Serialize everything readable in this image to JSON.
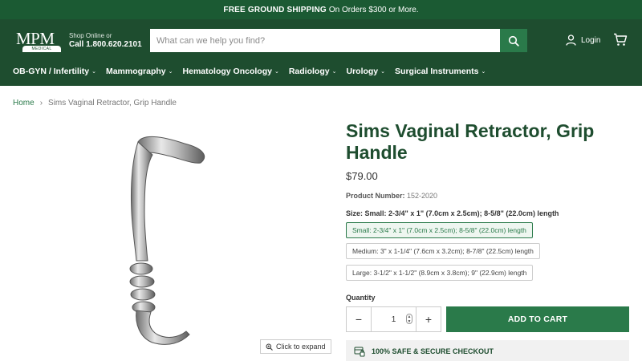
{
  "promo": {
    "strong": "FREE GROUND SHIPPING",
    "rest": "On Orders $300 or More."
  },
  "header": {
    "logo_text": "MPM",
    "logo_sub": "MEDICAL SUPPLY",
    "shop_online": "Shop Online or",
    "call": "Call 1.800.620.2101",
    "search_placeholder": "What can we help you find?",
    "login_label": "Login"
  },
  "nav": {
    "items": [
      {
        "label": "OB-GYN / Infertility"
      },
      {
        "label": "Mammography"
      },
      {
        "label": "Hematology Oncology"
      },
      {
        "label": "Radiology"
      },
      {
        "label": "Urology"
      },
      {
        "label": "Surgical Instruments"
      }
    ]
  },
  "breadcrumb": {
    "home": "Home",
    "separator": "›",
    "current": "Sims Vaginal Retractor, Grip Handle"
  },
  "product": {
    "title": "Sims Vaginal Retractor, Grip Handle",
    "price": "$79.00",
    "product_number_label": "Product Number:",
    "product_number": "152-2020",
    "size_label": "Size:",
    "size_selected": "Small: 2-3/4\" x 1\" (7.0cm x 2.5cm); 8-5/8\" (22.0cm) length",
    "options": [
      "Small: 2-3/4\" x 1\" (7.0cm x 2.5cm); 8-5/8\" (22.0cm) length",
      "Medium: 3\" x 1-1/4\" (7.6cm x 3.2cm); 8-7/8\" (22.5cm) length",
      "Large: 3-1/2\" x 1-1/2\" (8.9cm x 3.8cm); 9\" (22.9cm) length"
    ],
    "quantity_label": "Quantity",
    "quantity": "1",
    "minus": "−",
    "plus": "+",
    "add_to_cart": "ADD TO CART",
    "secure_checkout": "100% SAFE & SECURE CHECKOUT",
    "expand_label": "Click to expand"
  },
  "colors": {
    "header_green": "#1e4d2f",
    "accent_green": "#2a7a4a",
    "promo_green": "#1b5a33"
  }
}
